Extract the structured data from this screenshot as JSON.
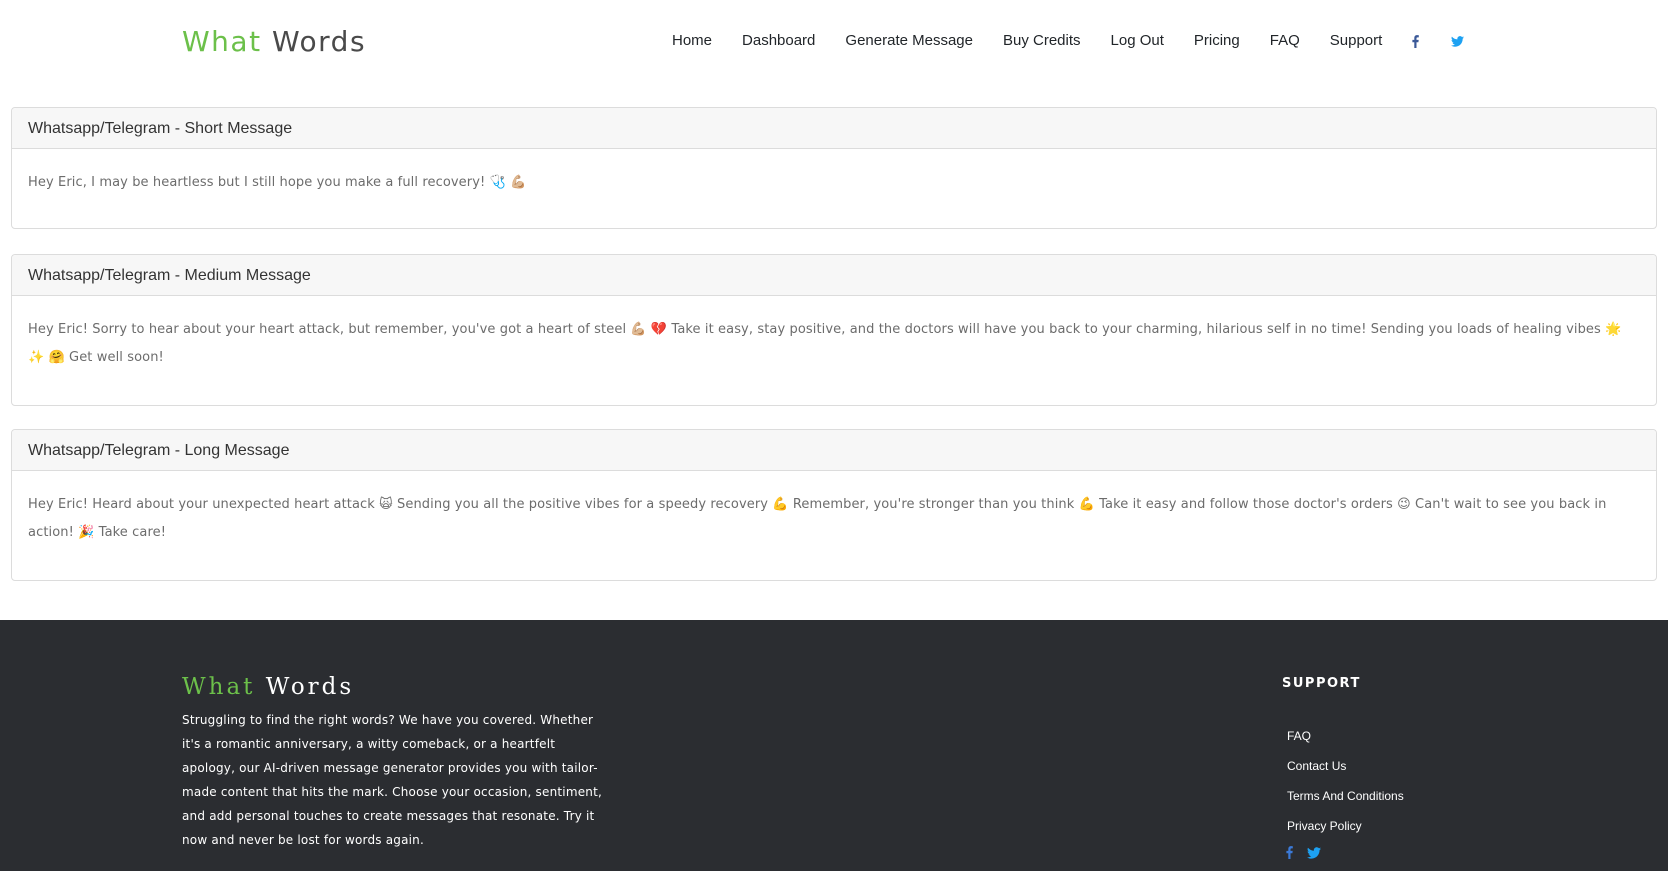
{
  "brand": {
    "word1": "What",
    "word2": "Words",
    "accent_color": "#6cc04a"
  },
  "nav": {
    "items": [
      {
        "label": "Home"
      },
      {
        "label": "Dashboard"
      },
      {
        "label": "Generate Message"
      },
      {
        "label": "Buy Credits"
      },
      {
        "label": "Log Out"
      },
      {
        "label": "Pricing"
      },
      {
        "label": "FAQ"
      },
      {
        "label": "Support"
      }
    ],
    "social": [
      {
        "icon": "facebook-icon",
        "color": "#3b5998"
      },
      {
        "icon": "twitter-icon",
        "color": "#1da1f2"
      }
    ]
  },
  "messages": [
    {
      "title": "Whatsapp/Telegram - Short Message",
      "body": "Hey Eric, I may be heartless but I still hope you make a full recovery! 🩺 💪🏼"
    },
    {
      "title": "Whatsapp/Telegram - Medium Message",
      "body": "Hey Eric! Sorry to hear about your heart attack, but remember, you've got a heart of steel 💪🏼 💔 Take it easy, stay positive, and the doctors will have you back to your charming, hilarious self in no time! Sending you loads of healing vibes 🌟 ✨ 🤗 Get well soon!"
    },
    {
      "title": "Whatsapp/Telegram - Long Message",
      "body": "Hey Eric! Heard about your unexpected heart attack 🙀 Sending you all the positive vibes for a speedy recovery 💪 Remember, you're stronger than you think 💪 Take it easy and follow those doctor's orders 😉 Can't wait to see you back in action! 🎉 Take care!"
    }
  ],
  "footer": {
    "description": "Struggling to find the right words? We have you covered. Whether it's a romantic anniversary, a witty comeback, or a heartfelt apology, our AI-driven message generator provides you with tailor-made content that hits the mark. Choose your occasion, sentiment, and add personal touches to create messages that resonate. Try it now and never be lost for words again.",
    "support_title": "SUPPORT",
    "support_links": [
      {
        "label": "FAQ"
      },
      {
        "label": "Contact Us"
      },
      {
        "label": "Terms And Conditions"
      },
      {
        "label": "Privacy Policy"
      }
    ],
    "background": "#2b2d31"
  }
}
